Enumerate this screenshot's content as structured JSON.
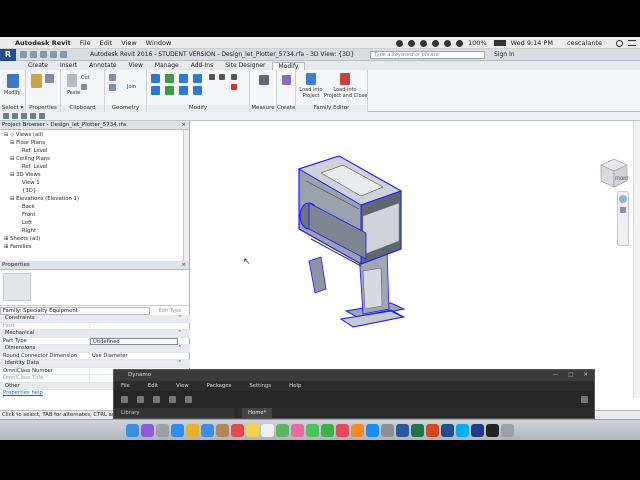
{
  "menubar": {
    "apple": "",
    "app": "Autodesk Revit",
    "items": [
      "File",
      "Edit",
      "View",
      "Window"
    ],
    "battery": "100%",
    "clock": "Wed 9:14 PM",
    "user": "cescalante"
  },
  "titlebar": {
    "title": "Autodesk Revit 2016 - STUDENT VERSION -    Design_let_Plotter_5734.rfa - 3D View: {3D}",
    "search_placeholder": "Type a keyword or phrase",
    "signin": "Sign In"
  },
  "ribbon_tabs": [
    "Create",
    "Insert",
    "Annotate",
    "View",
    "Manage",
    "Add-Ins",
    "Site Designer",
    "Modify"
  ],
  "ribbon": {
    "groups": [
      {
        "label": "Select ▾"
      },
      {
        "label": "Properties"
      },
      {
        "label": "Clipboard"
      },
      {
        "label": "Geometry"
      },
      {
        "label": "Modify"
      },
      {
        "label": "Measure"
      },
      {
        "label": "Create"
      },
      {
        "label": "Family Editor"
      }
    ],
    "modify_label": "Modify",
    "paste_label": "Paste",
    "cut_label": "Cut",
    "join_label": "Join",
    "load_into_project": "Load into\nProject",
    "load_into_project_close": "Load into\nProject and Close"
  },
  "project_browser": {
    "title": "Project Browser - Design_let_Plotter_5734.rfa",
    "nodes": [
      {
        "text": "⊟ ◇ Views (all)",
        "indent": 0
      },
      {
        "text": "⊟ Floor Plans",
        "indent": 1
      },
      {
        "text": "Ref. Level",
        "indent": 3
      },
      {
        "text": "⊟ Ceiling Plans",
        "indent": 1
      },
      {
        "text": "Ref. Level",
        "indent": 3
      },
      {
        "text": "⊟ 3D Views",
        "indent": 1
      },
      {
        "text": "View 1",
        "indent": 3
      },
      {
        "text": "{3D}",
        "indent": 3
      },
      {
        "text": "⊟ Elevations (Elevation 1)",
        "indent": 1
      },
      {
        "text": "Back",
        "indent": 3
      },
      {
        "text": "Front",
        "indent": 3
      },
      {
        "text": "Left",
        "indent": 3
      },
      {
        "text": "Right",
        "indent": 3
      },
      {
        "text": "⊞ Sheets (all)",
        "indent": 0
      },
      {
        "text": "⊞ Families",
        "indent": 0
      }
    ]
  },
  "properties": {
    "title": "Properties",
    "family_type": "Family: Specialty Equipment",
    "edit_type": "Edit Type",
    "rows": [
      {
        "k": "Constraints",
        "v": "",
        "section": true
      },
      {
        "k": "Host",
        "v": "",
        "grey": true
      },
      {
        "k": "Mechanical",
        "v": "",
        "section": true
      },
      {
        "k": "Part Type",
        "v": "Undefined",
        "field": true
      },
      {
        "k": "Dimensions",
        "v": "",
        "section": true
      },
      {
        "k": "Round Connector Dimension",
        "v": "Use Diameter"
      },
      {
        "k": "Identity Data",
        "v": "",
        "section": true
      },
      {
        "k": "OmniClass Number",
        "v": ""
      },
      {
        "k": "OmniClass Title",
        "v": "",
        "grey": true
      },
      {
        "k": "Other",
        "v": "",
        "section": true
      }
    ],
    "help_link": "Properties help"
  },
  "status": "Click to select, TAB for alternates, CTRL adds, SHIFT unselects.",
  "dynamo": {
    "title": "Dynamo",
    "menu": [
      "File",
      "Edit",
      "View",
      "Packages",
      "Settings",
      "Help"
    ],
    "library": "Library",
    "home_tab": "Home*"
  },
  "viewcube_label": "FRONT",
  "dock_icons": [
    "finder",
    "siri",
    "launchpad",
    "safari",
    "chrome",
    "mail",
    "contacts",
    "calendar",
    "notes",
    "reminders",
    "maps",
    "photos",
    "messages",
    "facetime",
    "itunes",
    "ibooks",
    "appstore",
    "prefs",
    "word",
    "excel",
    "powerpoint",
    "revit",
    "skype",
    "photoshop",
    "terminal",
    "trash"
  ],
  "colors": {
    "accent": "#1d4f91",
    "selection": "#1a1aff",
    "dynamo_bg": "#2b2b2b"
  }
}
